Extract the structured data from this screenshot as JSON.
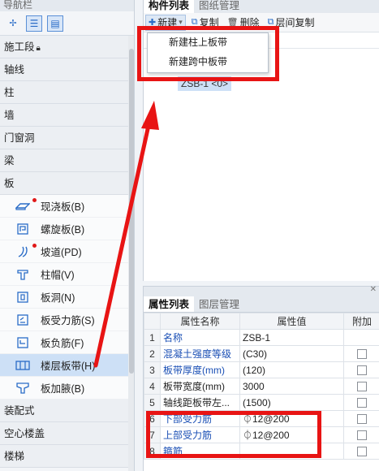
{
  "nav": {
    "title": "导航栏",
    "categories": {
      "construction": "施工段",
      "axis": "轴线",
      "column": "柱",
      "wall": "墙",
      "door_window": "门窗洞",
      "beam": "梁",
      "slab": "板",
      "prefab": "装配式",
      "hollow": "空心楼盖",
      "stairs": "楼梯"
    },
    "slab_items": [
      {
        "label": "现浇板(B)",
        "icon": "cast-slab-icon",
        "dot": true
      },
      {
        "label": "螺旋板(B)",
        "icon": "spiral-slab-icon",
        "dot": false
      },
      {
        "label": "坡道(PD)",
        "icon": "ramp-icon",
        "dot": true
      },
      {
        "label": "柱帽(V)",
        "icon": "column-cap-icon",
        "dot": false
      },
      {
        "label": "板洞(N)",
        "icon": "slab-hole-icon",
        "dot": false
      },
      {
        "label": "板受力筋(S)",
        "icon": "slab-rebar-icon",
        "dot": false
      },
      {
        "label": "板负筋(F)",
        "icon": "slab-neg-rebar-icon",
        "dot": false
      },
      {
        "label": "楼层板带(H)",
        "icon": "floor-strip-icon",
        "dot": false,
        "selected": true
      },
      {
        "label": "板加腋(B)",
        "icon": "slab-haunch-icon",
        "dot": false
      }
    ]
  },
  "component": {
    "tabs": [
      "构件列表",
      "图纸管理"
    ],
    "toolbar": {
      "new": "新建",
      "copy": "复制",
      "delete": "删除",
      "floor_copy": "层间复制"
    },
    "menu": [
      "新建柱上板带",
      "新建跨中板带"
    ],
    "tree_item": "ZSB-1 <0>"
  },
  "props": {
    "tabs": [
      "属性列表",
      "图层管理"
    ],
    "headers": [
      "属性名称",
      "属性值",
      "附加"
    ],
    "rows": [
      {
        "n": "1",
        "name": "名称",
        "value": "ZSB-1",
        "blue": true,
        "check": false
      },
      {
        "n": "2",
        "name": "混凝土强度等级",
        "value": "(C30)",
        "blue": true,
        "check": true
      },
      {
        "n": "3",
        "name": "板带厚度(mm)",
        "value": "(120)",
        "blue": true,
        "check": true
      },
      {
        "n": "4",
        "name": "板带宽度(mm)",
        "value": "3000",
        "blue": false,
        "check": true
      },
      {
        "n": "5",
        "name": "轴线距板带左...",
        "value": "(1500)",
        "blue": false,
        "check": true
      },
      {
        "n": "6",
        "name": "下部受力筋",
        "value": "⏀12@200",
        "blue": true,
        "check": true
      },
      {
        "n": "7",
        "name": "上部受力筋",
        "value": "⏀12@200",
        "blue": true,
        "check": true
      },
      {
        "n": "8",
        "name": "箍筋",
        "value": "",
        "blue": true,
        "check": true
      }
    ]
  },
  "colors": {
    "annotation": "#e81414",
    "selection": "#cde0f6",
    "link": "#1a4fb5"
  }
}
